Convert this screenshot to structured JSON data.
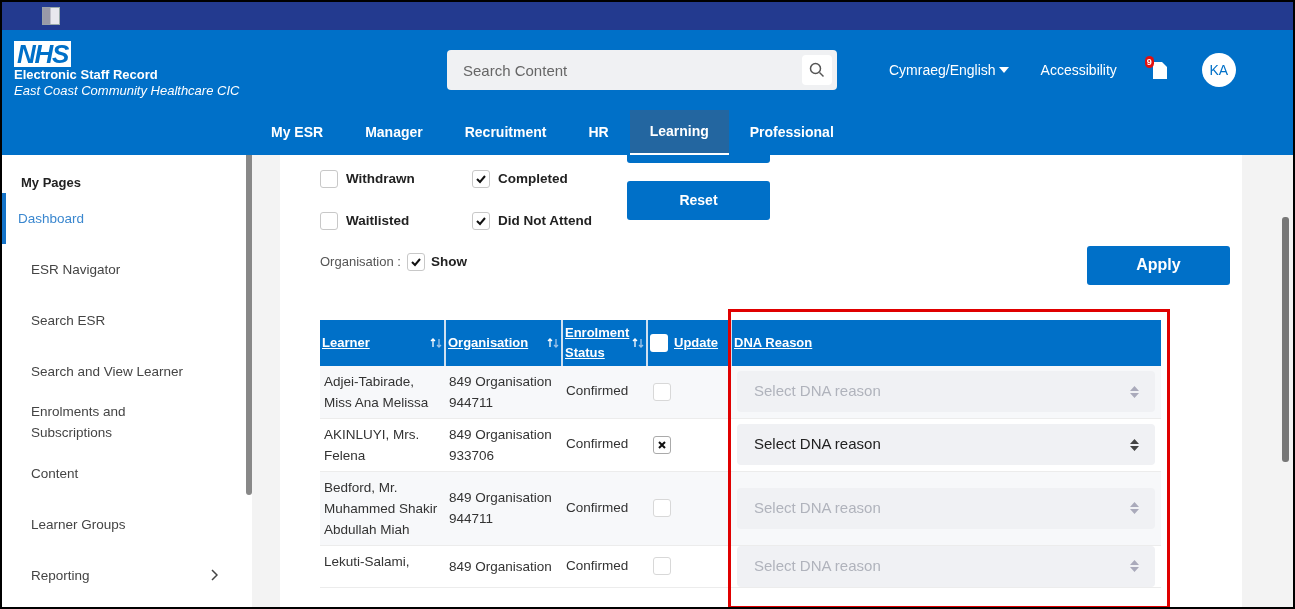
{
  "header": {
    "org_name": "Electronic Staff Record",
    "org_sub": "East Coast Community Healthcare CIC",
    "logo": "NHS",
    "search": {
      "placeholder": "Search Content"
    },
    "language": "Cymraeg/English",
    "accessibility": "Accessibility",
    "notifications": "9",
    "avatar": "KA"
  },
  "tabs": [
    {
      "label": "My ESR",
      "selected": false
    },
    {
      "label": "Manager",
      "selected": false
    },
    {
      "label": "Recruitment",
      "selected": false
    },
    {
      "label": "HR",
      "selected": false
    },
    {
      "label": "Learning",
      "selected": true
    },
    {
      "label": "Professional",
      "selected": false
    }
  ],
  "sidebar": {
    "title": "My Pages",
    "items": [
      {
        "label": "Dashboard",
        "selected": true,
        "has_submenu": false
      },
      {
        "label": "ESR Navigator",
        "selected": false,
        "has_submenu": false
      },
      {
        "label": "Search ESR",
        "selected": false,
        "has_submenu": false
      },
      {
        "label": "Search and View Learner",
        "selected": false,
        "has_submenu": false
      },
      {
        "label": "Enrolments and Subscriptions",
        "selected": false,
        "has_submenu": false
      },
      {
        "label": "Content",
        "selected": false,
        "has_submenu": false
      },
      {
        "label": "Learner Groups",
        "selected": false,
        "has_submenu": false
      },
      {
        "label": "Reporting",
        "selected": false,
        "has_submenu": true
      }
    ]
  },
  "filters": [
    {
      "label": "Withdrawn",
      "checked": false
    },
    {
      "label": "Completed",
      "checked": true
    },
    {
      "label": "Waitlisted",
      "checked": false
    },
    {
      "label": "Did Not Attend",
      "checked": true
    }
  ],
  "reset_button": "Reset",
  "organisation": {
    "label": "Organisation :",
    "option": "Show",
    "checked": true
  },
  "apply_button": "Apply",
  "table": {
    "columns": [
      {
        "label": "Learner",
        "sortable": true
      },
      {
        "label": "Organisation",
        "sortable": true
      },
      {
        "label": "Enrolment Status",
        "sortable": true
      },
      {
        "label": "Update",
        "sortable": false
      },
      {
        "label": "DNA Reason",
        "sortable": false
      }
    ],
    "update_all_checked": false,
    "rows": [
      {
        "learner": "Adjei-Tabirade, Miss Ana Melissa",
        "organisation": "849 Organisation 944711",
        "status": "Confirmed",
        "update": false,
        "dna": {
          "placeholder": "Select DNA reason",
          "disabled": true
        }
      },
      {
        "learner": "AKINLUYI, Mrs. Felena",
        "organisation": "849 Organisation 933706",
        "status": "Confirmed",
        "update": true,
        "dna": {
          "placeholder": "Select DNA reason",
          "disabled": false
        }
      },
      {
        "learner": "Bedford, Mr. Muhammed Shakir Abdullah Miah",
        "organisation": "849 Organisation 944711",
        "status": "Confirmed",
        "update": false,
        "dna": {
          "placeholder": "Select DNA reason",
          "disabled": true
        }
      },
      {
        "learner": "Lekuti-Salami,",
        "organisation": "849 Organisation",
        "status": "Confirmed",
        "update": false,
        "dna": {
          "placeholder": "Select DNA reason",
          "disabled": true
        }
      }
    ]
  }
}
